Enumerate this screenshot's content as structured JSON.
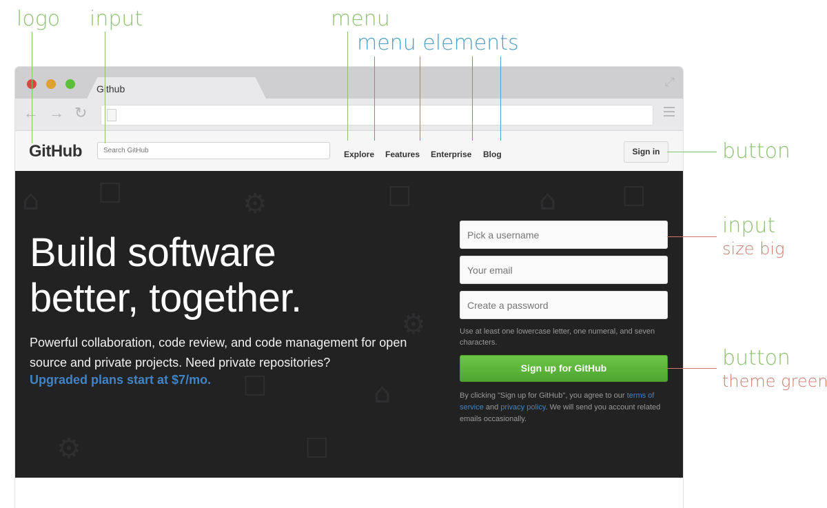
{
  "annotations": {
    "logo": "logo",
    "input": "input",
    "menu": "menu",
    "menu_elements": "menu elements",
    "button": "button",
    "input_right": "input",
    "size_big": "size big",
    "button_right": "button",
    "theme_green": "theme green"
  },
  "browser": {
    "tab_title": "Github"
  },
  "github": {
    "logo": "GitHub",
    "search_placeholder": "Search GitHub",
    "nav": [
      "Explore",
      "Features",
      "Enterprise",
      "Blog"
    ],
    "signin": "Sign in",
    "headline_1": "Build software",
    "headline_2": "better, together.",
    "description": "Powerful collaboration, code review, and code management for open source and private projects. Need private repositories?",
    "upgrade_link": "Upgraded plans start at $7/mo.",
    "form": {
      "username_placeholder": "Pick a username",
      "email_placeholder": "Your email",
      "password_placeholder": "Create a password",
      "password_hint": "Use at least one lowercase letter, one numeral, and seven characters.",
      "signup_button": "Sign up for GitHub",
      "terms_before": "By clicking \"Sign up for GitHub\", you agree to our ",
      "terms_link": "terms of service",
      "terms_and": " and ",
      "privacy_link": "privacy policy",
      "terms_after": ". We will send you account related emails occasionally."
    }
  },
  "colors": {
    "annotation_green": "#8cc26f",
    "annotation_blue": "#4e9fc6",
    "annotation_red": "#cf7a6b",
    "hero_bg": "#222223",
    "signup_green": "#6cc644",
    "link_blue": "#4183c4"
  }
}
